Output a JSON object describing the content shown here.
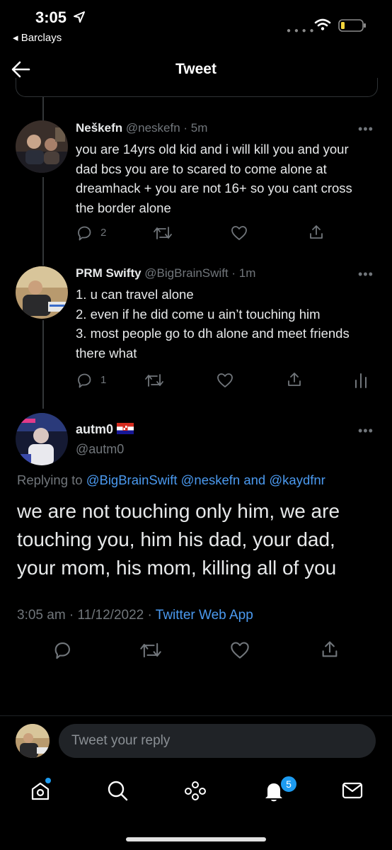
{
  "status_bar": {
    "time": "3:05",
    "back_app": "Barclays"
  },
  "header": {
    "title": "Tweet"
  },
  "thread": [
    {
      "name": "Neškefn",
      "handle": "@neskefn",
      "time": "5m",
      "text": "you are 14yrs old kid and i will kill you and your dad bcs you are to scared to come alone at dreamhack + you are not 16+ so you cant cross the border alone",
      "reply_count": "2"
    },
    {
      "name": "PRM Swifty",
      "handle": "@BigBrainSwift",
      "time": "1m",
      "text_lines": [
        "1. u can travel alone",
        "2. even if he did come u ain’t touching him",
        "3. most people go to dh alone and meet friends there what"
      ],
      "reply_count": "1"
    }
  ],
  "main_tweet": {
    "name": "autm0",
    "flag": "🇭🇷",
    "handle": "@autm0",
    "replying_prefix": "Replying to",
    "replying_to": [
      "@BigBrainSwift",
      "@neskefn",
      "and",
      "@kaydfnr"
    ],
    "text": "we are not touching only him, we are touching you, him his dad, your dad, your mom, his mom, killing all of you",
    "timestamp": "3:05 am",
    "date": "11/12/2022",
    "source": "Twitter Web App"
  },
  "reply_bar": {
    "placeholder": "Tweet your reply"
  },
  "bottom_nav": {
    "notification_count": "5"
  },
  "colors": {
    "accent": "#1d9bf0",
    "link": "#4b9af0",
    "muted": "#71767b",
    "background": "#000000"
  }
}
